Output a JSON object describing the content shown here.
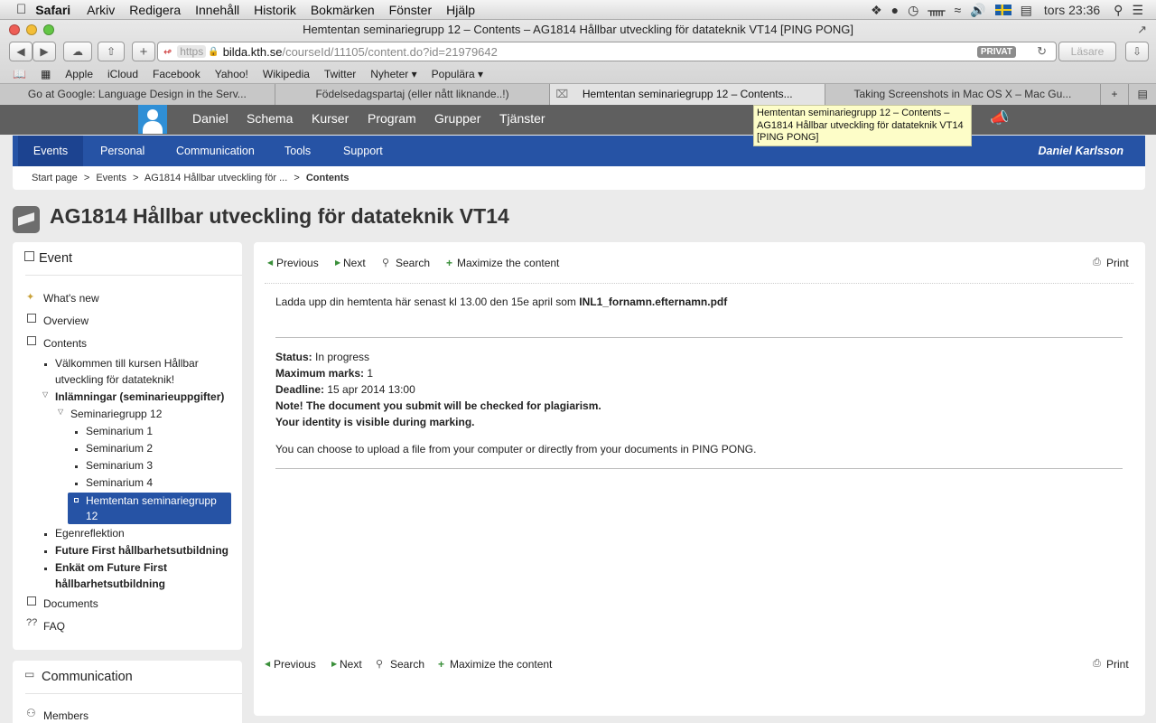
{
  "menubar": {
    "app": "Safari",
    "items": [
      "Arkiv",
      "Redigera",
      "Innehåll",
      "Historik",
      "Bokmärken",
      "Fönster",
      "Hjälp"
    ],
    "clock": "tors 23:36"
  },
  "window": {
    "title": "Hemtentan seminariegrupp 12 – Contents – AG1814 Hållbar utveckling för datateknik VT14 [PING PONG]"
  },
  "url": {
    "scheme": "https",
    "host": "bilda.kth.se",
    "path": "/courseId/11105/content.do?id=21979642"
  },
  "toolbar": {
    "private": "PRIVAT",
    "reader": "Läsare"
  },
  "bookmarks": [
    "Apple",
    "iCloud",
    "Facebook",
    "Yahoo!",
    "Wikipedia",
    "Twitter",
    "Nyheter ▾",
    "Populära ▾"
  ],
  "tabs": [
    {
      "label": "Go at Google: Language Design in the Serv..."
    },
    {
      "label": "Födelsedagspartaj (eller nått liknande..!)"
    },
    {
      "label": "Hemtentan seminariegrupp 12 – Contents..."
    },
    {
      "label": "Taking Screenshots in Mac OS X – Mac Gu..."
    }
  ],
  "tooltip": "Hemtentan seminariegrupp 12 – Contents – AG1814 Hållbar utveckling för datateknik VT14 [PING PONG]",
  "topnav": {
    "user": "Daniel",
    "items": [
      "Schema",
      "Kurser",
      "Program",
      "Grupper",
      "Tjänster"
    ]
  },
  "bluenav": {
    "items": [
      "Events",
      "Personal",
      "Communication",
      "Tools",
      "Support"
    ],
    "user": "Daniel Karlsson"
  },
  "breadcrumb": {
    "items": [
      "Start page",
      "Events",
      "AG1814 Hållbar utveckling för ..."
    ],
    "current": "Contents",
    "sep": ">"
  },
  "page_title": "AG1814 Hållbar utveckling för datateknik VT14",
  "sidebar": {
    "event_title": "Event",
    "whats_new": "What's new",
    "overview": "Overview",
    "contents": "Contents",
    "tree": {
      "welcome_1": "Välkommen till kursen Hållbar",
      "welcome_2": "utveckling för datateknik!",
      "inlamningar": "Inlämningar (seminarieuppgifter)",
      "seminariegrupp": "Seminariegrupp 12",
      "sem1": "Seminarium 1",
      "sem2": "Seminarium 2",
      "sem3": "Seminarium 3",
      "sem4": "Seminarium 4",
      "hemtentan_1": "Hemtentan seminariegrupp",
      "hemtentan_2": "12",
      "egenreflektion": "Egenreflektion",
      "future_first": "Future First hållbarhetsutbildning",
      "enkat_1": "Enkät om Future First",
      "enkat_2": "hållbarhetsutbildning"
    },
    "documents": "Documents",
    "faq": "FAQ",
    "communication_title": "Communication",
    "members": "Members"
  },
  "actions": {
    "previous": "Previous",
    "next": "Next",
    "search": "Search",
    "maximize": "Maximize the content",
    "print": "Print"
  },
  "content": {
    "upload_prefix": "Ladda upp din hemtenta här senast kl 13.00 den 15e april som ",
    "upload_file": "INL1_fornamn.efternamn.pdf",
    "status_label": "Status:",
    "status_value": "In progress",
    "max_label": "Maximum marks:",
    "max_value": "1",
    "deadline_label": "Deadline:",
    "deadline_value": "15 apr 2014 13:00",
    "note1": "Note! The document you submit will be checked for plagiarism.",
    "note2": "Your identity is visible during marking.",
    "choose": "You can choose to upload a file from your computer or directly from your documents in PING PONG."
  },
  "colors": {
    "brand_blue": "#2653a5",
    "dark_nav": "#5f5f5f",
    "tooltip_bg": "#fdfdc8"
  }
}
